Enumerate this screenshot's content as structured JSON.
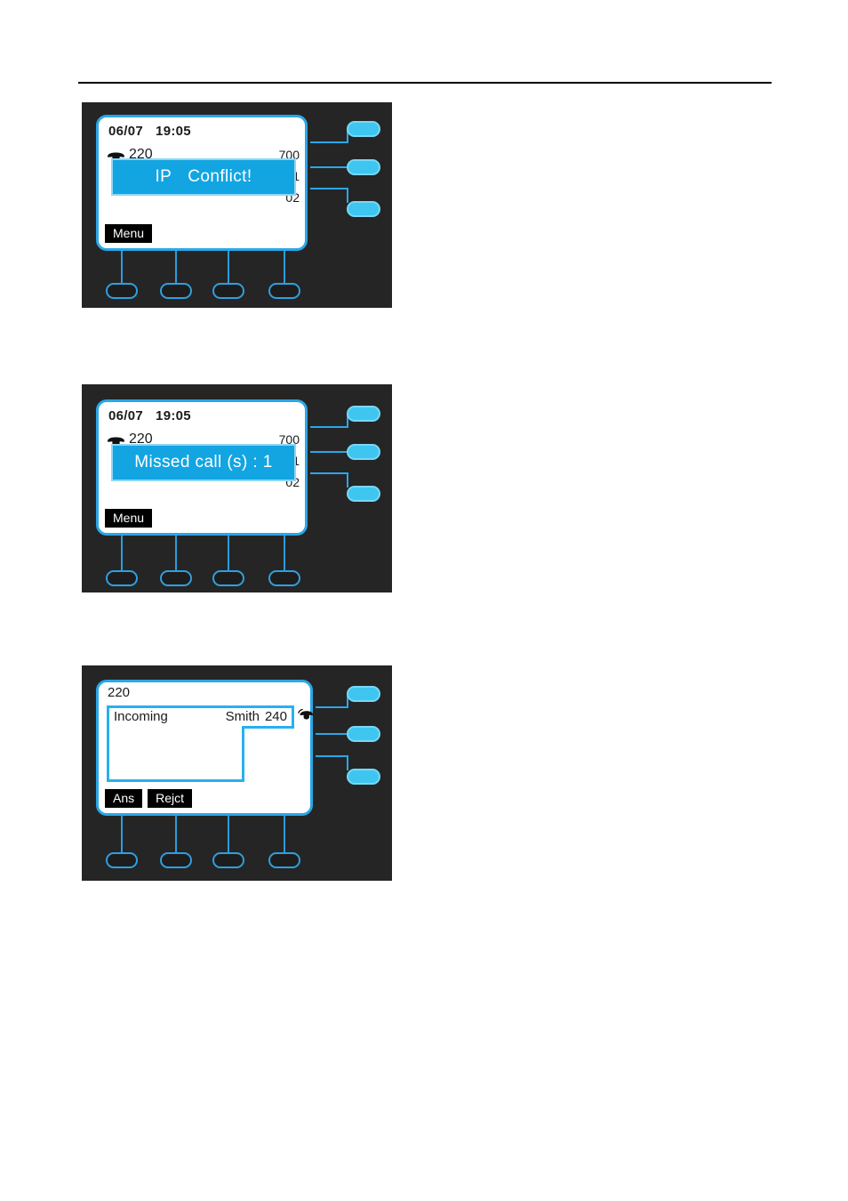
{
  "page": {
    "background": "#ffffff",
    "rule_color": "#000000"
  },
  "palette": {
    "panel_bg": "#252525",
    "lcd_bg": "#ffffff",
    "accent_cyan": "#2aa7e8",
    "popup_fill": "#12a5e2",
    "popup_border": "#8fd6f5",
    "linekey_fill": "#3ec6f0",
    "softkey_bg": "#000000",
    "text_dark": "#1b1b1b",
    "text_light": "#ffffff"
  },
  "figures": [
    {
      "id": "ip-conflict",
      "status": {
        "date": "06/07",
        "time": "19:05"
      },
      "account": {
        "icon": "handset-icon",
        "number": "220"
      },
      "line_labels": [
        "700",
        "01",
        "02"
      ],
      "popup": {
        "text_left": "IP",
        "text_right": "Conflict!"
      },
      "softkeys": [
        "Menu"
      ],
      "line_keys": [
        "line-key-1",
        "line-key-2",
        "line-key-3"
      ],
      "soft_buttons": [
        "soft-button-1",
        "soft-button-2",
        "soft-button-3",
        "soft-button-4"
      ]
    },
    {
      "id": "missed-calls",
      "status": {
        "date": "06/07",
        "time": "19:05"
      },
      "account": {
        "icon": "handset-icon",
        "number": "220"
      },
      "line_labels": [
        "700",
        "01",
        "02"
      ],
      "popup": {
        "text": "Missed call (s) : 1"
      },
      "softkeys": [
        "Menu"
      ],
      "line_keys": [
        "line-key-1",
        "line-key-2",
        "line-key-3"
      ],
      "soft_buttons": [
        "soft-button-1",
        "soft-button-2",
        "soft-button-3",
        "soft-button-4"
      ]
    },
    {
      "id": "incoming-call",
      "header": "220",
      "call": {
        "state": "Incoming",
        "caller_name": "Smith",
        "caller_number": "240",
        "icon": "incoming-call-icon"
      },
      "softkeys": [
        "Ans",
        "Rejct"
      ],
      "line_keys": [
        "line-key-1",
        "line-key-2",
        "line-key-3"
      ],
      "soft_buttons": [
        "soft-button-1",
        "soft-button-2",
        "soft-button-3",
        "soft-button-4"
      ]
    }
  ]
}
